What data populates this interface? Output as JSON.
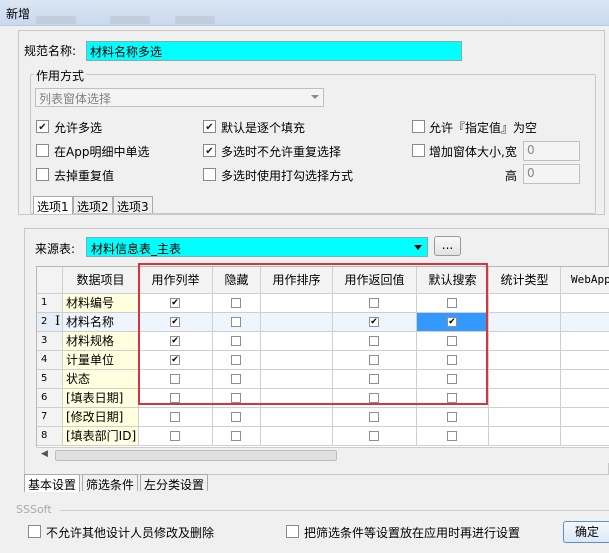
{
  "window": {
    "title": "新增"
  },
  "spec_name": {
    "label": "规范名称:",
    "value": "材料名称多选"
  },
  "mode_group": {
    "title": "作用方式",
    "combo_value": "列表窗体选择",
    "options": [
      {
        "label": "允许多选",
        "checked": true
      },
      {
        "label": "默认是逐个填充",
        "checked": true
      },
      {
        "label": "允许『指定值』为空",
        "checked": false
      },
      {
        "label": "在App明细中单选",
        "checked": false
      },
      {
        "label": "多选时不允许重复选择",
        "checked": true
      },
      {
        "label": "增加窗体大小,宽",
        "checked": false
      },
      {
        "label": "去掉重复值",
        "checked": false
      },
      {
        "label": "多选时使用打勾选择方式",
        "checked": false
      }
    ],
    "width_value": "0",
    "height_label": "高",
    "height_value": "0"
  },
  "option_tabs": [
    "选项1",
    "选项2",
    "选项3"
  ],
  "source_table": {
    "label": "来源表:",
    "value": "材料信息表_主表",
    "browse_label": "..."
  },
  "grid": {
    "columns": [
      "",
      "数据项目",
      "用作列举",
      "隐藏",
      "用作排序",
      "用作返回值",
      "默认搜索",
      "统计类型",
      "WebApp"
    ],
    "rows": [
      {
        "num": "1",
        "name": "材料编号",
        "list": true,
        "hide": false,
        "ret": false,
        "search": false
      },
      {
        "num": "2",
        "name": "材料名称",
        "list": true,
        "hide": false,
        "ret": true,
        "search": true
      },
      {
        "num": "3",
        "name": "材料规格",
        "list": true,
        "hide": false,
        "ret": false,
        "search": false
      },
      {
        "num": "4",
        "name": "计量单位",
        "list": true,
        "hide": false,
        "ret": false,
        "search": false
      },
      {
        "num": "5",
        "name": "状态",
        "list": false,
        "hide": false,
        "ret": false,
        "search": false
      },
      {
        "num": "6",
        "name": "[填表日期]",
        "list": false,
        "hide": false,
        "ret": false,
        "search": false
      },
      {
        "num": "7",
        "name": "[修改日期]",
        "list": false,
        "hide": false,
        "ret": false,
        "search": false
      },
      {
        "num": "8",
        "name": "[填表部门ID]",
        "list": false,
        "hide": false,
        "ret": false,
        "search": false
      }
    ],
    "row_marker": "I"
  },
  "bottom_tabs": [
    "基本设置",
    "筛选条件",
    "左分类设置"
  ],
  "footer": {
    "brand": "SSSoft",
    "no_modify": {
      "label": "不允许其他设计人员修改及删除",
      "checked": false
    },
    "apply_later": {
      "label": "把筛选条件等设置放在应用时再进行设置",
      "checked": false
    },
    "confirm_label": "确定"
  },
  "colors": {
    "highlight": "#00ffff",
    "redbox": "#d9333f",
    "selected_cell": "#3399ff"
  }
}
